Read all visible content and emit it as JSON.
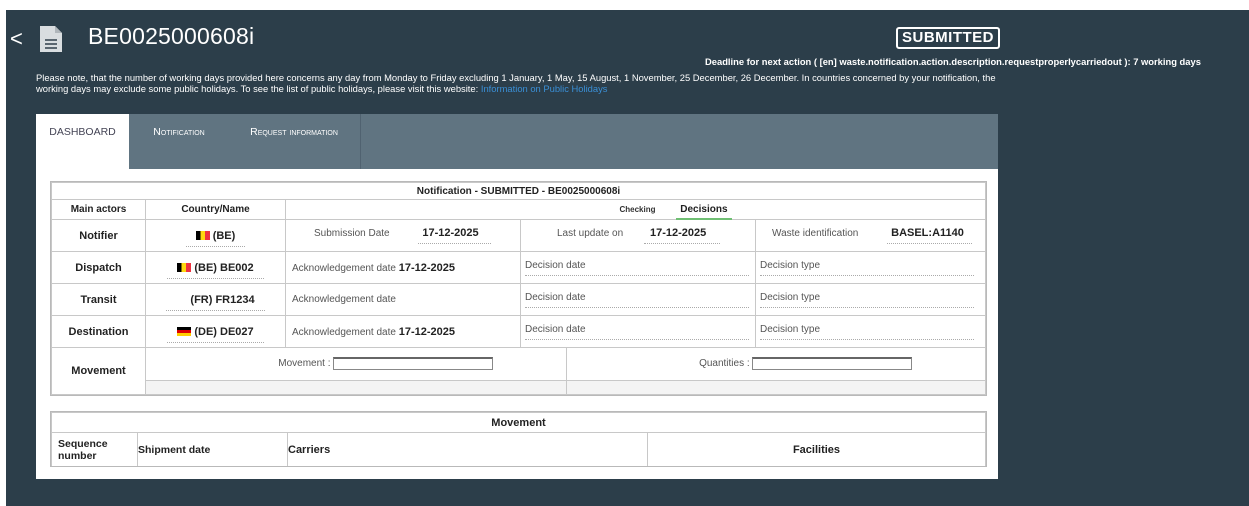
{
  "header": {
    "back_glyph": "<",
    "title": "BE0025000608i",
    "status": "SUBMITTED",
    "deadline": "Deadline for next action ( [en] waste.notification.action.description.requestproperlycarriedout ): 7 working days",
    "note": "Please note, that the number of working days provided here concerns any day from Monday to Friday excluding 1 January, 1 May, 15 August, 1 November, 25 December, 26 December. In countries concerned by your notification, the working days may exclude some public holidays. To see the list of public holidays, please visit this website: ",
    "note_link": "Information on Public Holidays"
  },
  "tabs": [
    {
      "label": "DASHBOARD"
    },
    {
      "label": "Notification"
    },
    {
      "label": "Request information"
    }
  ],
  "notification": {
    "heading": "Notification - SUBMITTED - BE0025000608i",
    "col_actors": "Main actors",
    "col_country": "Country/Name",
    "checking": "Checking",
    "decisions": "Decisions",
    "rows": [
      {
        "label": "Notifier",
        "country": "(BE)"
      },
      {
        "label": "Dispatch",
        "country": "(BE) BE002"
      },
      {
        "label": "Transit",
        "country": "(FR) FR1234"
      },
      {
        "label": "Destination",
        "country": "(DE) DE027"
      }
    ],
    "submission_label": "Submission Date",
    "submission_value": "17-12-2025",
    "lastupdate_label": "Last update on",
    "lastupdate_value": "17-12-2025",
    "waste_label": "Waste identification",
    "waste_value": "BASEL:A1140",
    "ack_label": "Acknowledgement date",
    "ack_dispatch": "17-12-2025",
    "ack_destination": "17-12-2025",
    "decision_date_label": "Decision date",
    "decision_type_label": "Decision type",
    "movement_label": "Movement",
    "movement_field_label": "Movement :",
    "quantities_label": "Quantities :"
  },
  "movement": {
    "heading": "Movement",
    "col_sequence": "Sequence number",
    "col_shipment": "Shipment date",
    "col_carriers": "Carriers",
    "col_facilities": "Facilities"
  }
}
